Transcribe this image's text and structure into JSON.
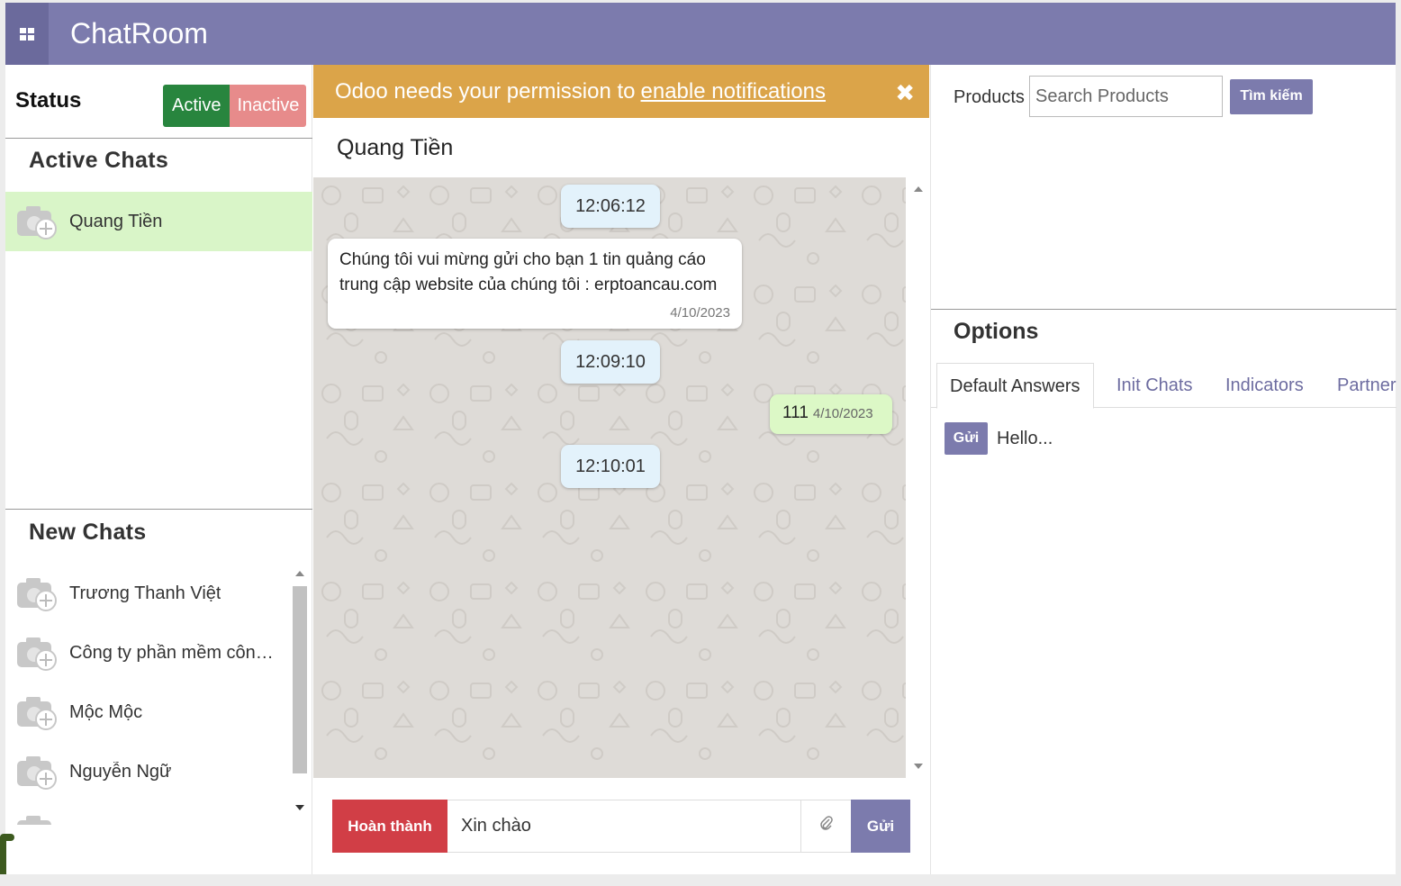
{
  "app": {
    "title": "ChatRoom",
    "menu_icon": "apps-grid-icon",
    "accent": "#7c7bad"
  },
  "status": {
    "label": "Status",
    "active_label": "Active",
    "inactive_label": "Inactive"
  },
  "active_chats": {
    "title": "Active Chats",
    "items": [
      {
        "name": "Quang Tiền",
        "avatar_icon": "camera-plus-icon"
      }
    ]
  },
  "new_chats": {
    "title": "New Chats",
    "items": [
      {
        "name": "Trương Thanh Việt"
      },
      {
        "name": "Công ty phần mềm công..."
      },
      {
        "name": "Mộc Mộc"
      },
      {
        "name": "Nguyễn Ngữ"
      }
    ]
  },
  "notification": {
    "text": "Odoo needs your permission to",
    "link": "enable notifications",
    "close": "✖"
  },
  "conversation": {
    "contact_name": "Quang Tiền",
    "messages": [
      {
        "type": "time",
        "text": "12:06:12"
      },
      {
        "type": "incoming",
        "text": "Chúng tôi vui mừng gửi cho bạn 1 tin quảng cáo trung cập website của chúng tôi : erptoancau.com",
        "date": "4/10/2023"
      },
      {
        "type": "time",
        "text": "12:09:10"
      },
      {
        "type": "outgoing",
        "text": "111",
        "date": "4/10/2023"
      },
      {
        "type": "time",
        "text": "12:10:01"
      }
    ]
  },
  "composer": {
    "done_label": "Hoàn thành",
    "input_value": "Xin chào",
    "attach_icon": "paperclip-icon",
    "send_label": "Gửi"
  },
  "products": {
    "label": "Products",
    "search_placeholder": "Search Products",
    "search_button": "Tìm kiếm"
  },
  "options": {
    "title": "Options",
    "tabs": [
      "Default Answers",
      "Init Chats",
      "Indicators",
      "Partner"
    ],
    "active_tab": "Default Answers",
    "default_answers": [
      {
        "button": "Gửi",
        "text": "Hello..."
      }
    ]
  }
}
